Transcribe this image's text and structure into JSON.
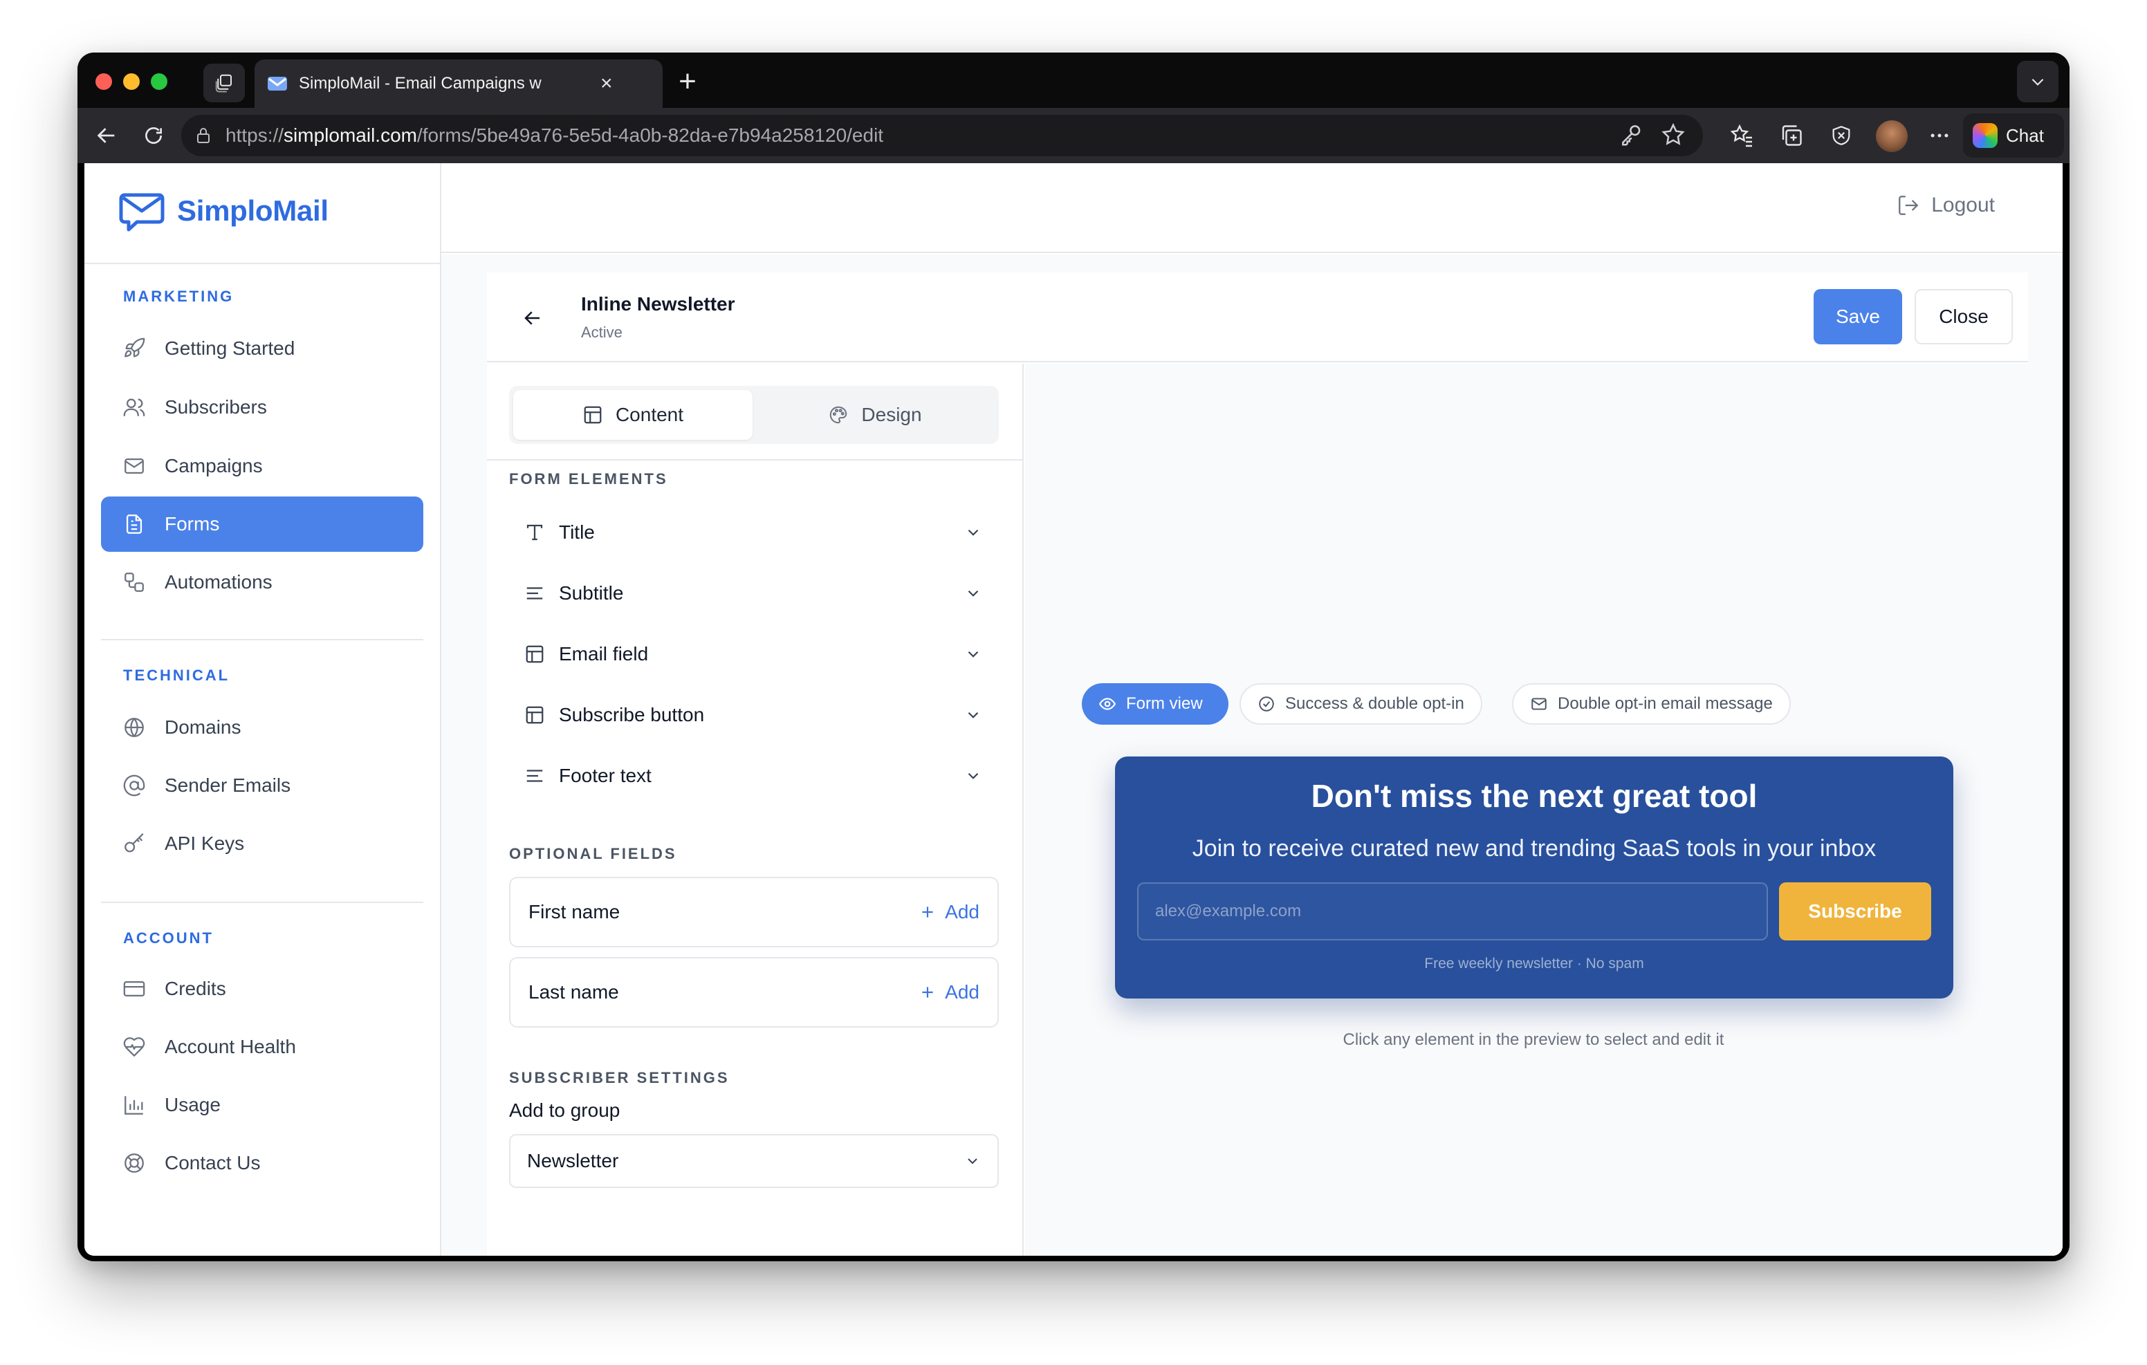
{
  "browser": {
    "tab_title": "SimploMail - Email Campaigns w",
    "url_scheme": "https://",
    "url_host": "simplomail.com",
    "url_path": "/forms/5be49a76-5e5d-4a0b-82da-e7b94a258120/edit",
    "chat_label": "Chat"
  },
  "app": {
    "brand": "SimploMail",
    "logout_label": "Logout"
  },
  "sidebar": {
    "marketing_heading": "MARKETING",
    "marketing": [
      {
        "label": "Getting Started",
        "icon": "rocket-icon"
      },
      {
        "label": "Subscribers",
        "icon": "users-icon"
      },
      {
        "label": "Campaigns",
        "icon": "mail-icon"
      },
      {
        "label": "Forms",
        "icon": "document-icon",
        "active": true
      },
      {
        "label": "Automations",
        "icon": "workflow-icon"
      }
    ],
    "technical_heading": "TECHNICAL",
    "technical": [
      {
        "label": "Domains",
        "icon": "globe-icon"
      },
      {
        "label": "Sender Emails",
        "icon": "at-sign-icon"
      },
      {
        "label": "API Keys",
        "icon": "key-icon"
      }
    ],
    "account_heading": "ACCOUNT",
    "account": [
      {
        "label": "Credits",
        "icon": "credit-card-icon"
      },
      {
        "label": "Account Health",
        "icon": "heart-pulse-icon"
      },
      {
        "label": "Usage",
        "icon": "bar-chart-icon"
      },
      {
        "label": "Contact Us",
        "icon": "lifebuoy-icon"
      }
    ]
  },
  "editor": {
    "form_name": "Inline Newsletter",
    "status": "Active",
    "save_label": "Save",
    "close_label": "Close",
    "tabs": [
      {
        "label": "Content",
        "icon": "layout-icon",
        "selected": true
      },
      {
        "label": "Design",
        "icon": "palette-icon",
        "selected": false
      }
    ],
    "form_elements_heading": "FORM ELEMENTS",
    "form_elements": [
      {
        "label": "Title",
        "icon": "type-icon"
      },
      {
        "label": "Subtitle",
        "icon": "align-left-icon"
      },
      {
        "label": "Email field",
        "icon": "layout-icon"
      },
      {
        "label": "Subscribe button",
        "icon": "layout-icon"
      },
      {
        "label": "Footer text",
        "icon": "align-left-icon"
      }
    ],
    "optional_fields_heading": "OPTIONAL FIELDS",
    "optional_fields": [
      {
        "label": "First name",
        "action": "Add"
      },
      {
        "label": "Last name",
        "action": "Add"
      }
    ],
    "subscriber_settings_heading": "SUBSCRIBER SETTINGS",
    "add_to_group_label": "Add to group",
    "group_value": "Newsletter"
  },
  "preview": {
    "view_tabs": [
      {
        "label": "Form view",
        "icon": "eye-icon",
        "active": true
      },
      {
        "label": "Success & double opt-in",
        "icon": "check-circle-icon",
        "active": false
      },
      {
        "label": "Double opt-in email message",
        "icon": "mail-icon",
        "active": false
      }
    ],
    "card": {
      "title": "Don't miss the next great tool",
      "subtitle": "Join to receive curated new and trending SaaS tools in your inbox",
      "email_placeholder": "alex@example.com",
      "button_label": "Subscribe",
      "footer": "Free weekly newsletter · No spam",
      "background": "#28509c",
      "button_color": "#f0b43c"
    },
    "hint": "Click any element in the preview to select and edit it"
  },
  "colors": {
    "accent": "#4b82ea",
    "brand": "#2f6be0"
  }
}
